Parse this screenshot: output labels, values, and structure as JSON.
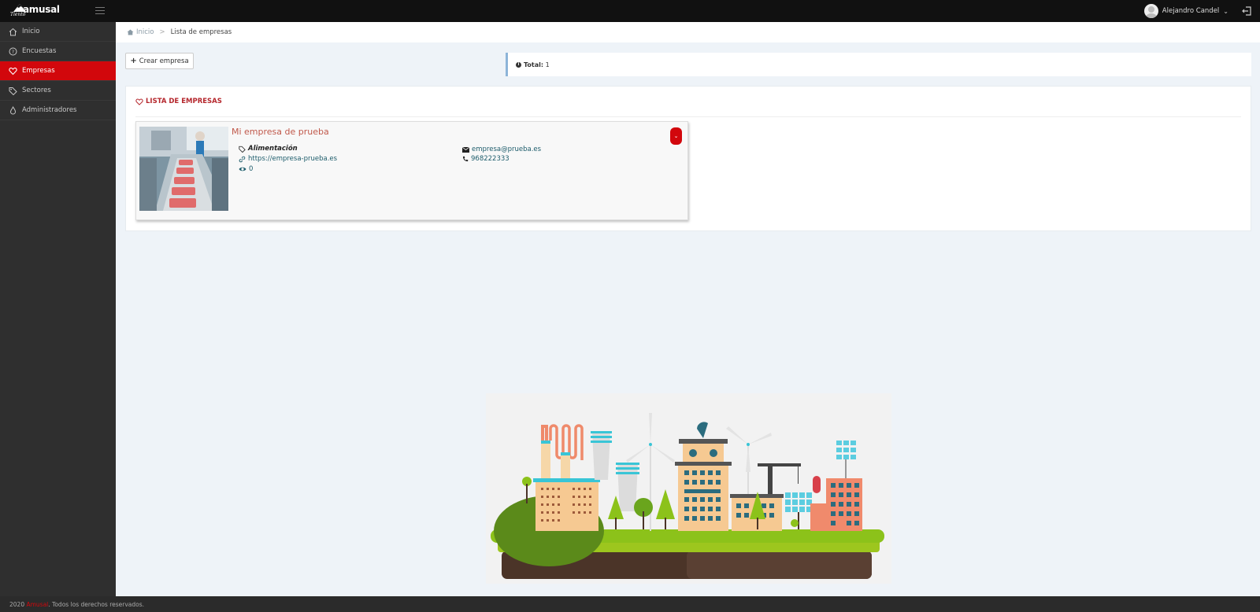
{
  "app": {
    "logo_text": "amusal",
    "logo_script": "Tiento"
  },
  "header": {
    "user_name": "Alejandro Candel"
  },
  "sidebar": {
    "items": [
      {
        "label": "Inicio",
        "icon": "home-icon",
        "active": false
      },
      {
        "label": "Encuestas",
        "icon": "question-circle-icon",
        "active": false
      },
      {
        "label": "Empresas",
        "icon": "heart-icon",
        "active": true
      },
      {
        "label": "Sectores",
        "icon": "tag-icon",
        "active": false
      },
      {
        "label": "Administradores",
        "icon": "fire-icon",
        "active": false
      }
    ]
  },
  "breadcrumb": {
    "home": "Inicio",
    "current": "Lista de empresas"
  },
  "toolbar": {
    "create_label": "Crear empresa"
  },
  "summary": {
    "total_label": "Total:",
    "total_value": "1"
  },
  "list": {
    "title": "LISTA DE EMPRESAS",
    "companies": [
      {
        "name": "Mi empresa de prueba",
        "sector": "Alimentación",
        "website": "https://empresa-prueba.es",
        "views": "0",
        "email": "empresa@prueba.es",
        "phone": "968222333"
      }
    ]
  },
  "footer": {
    "year": "2020",
    "brand": "Amusal",
    "rights": ". Todos los derechos reservados."
  },
  "colors": {
    "accent": "#d2070c",
    "sidebar_bg": "#2f2f2f",
    "topbar_bg": "#111111",
    "content_bg": "#eef3f8",
    "company_link": "#c0594b"
  }
}
